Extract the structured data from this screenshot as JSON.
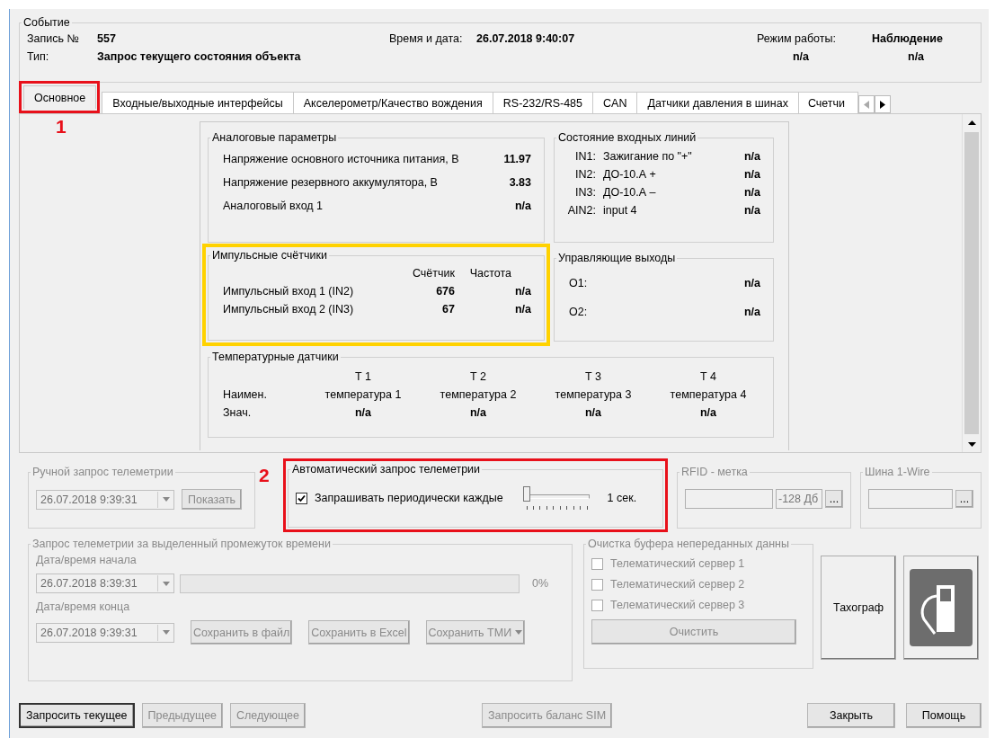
{
  "event": {
    "title": "Событие",
    "record_label": "Запись №",
    "record": "557",
    "datetime_label": "Время и дата:",
    "datetime": "26.07.2018 9:40:07",
    "mode_label": "Режим работы:",
    "mode": "Наблюдение",
    "type_label": "Тип:",
    "type": "Запрос текущего состояния объекта",
    "status_1": "n/a",
    "status_2": "n/a"
  },
  "tabs": [
    {
      "label": "Основное",
      "selected": true,
      "callout": "1"
    },
    {
      "label": "Входные/выходные интерфейсы",
      "selected": false
    },
    {
      "label": "Акселерометр/Качество вождения",
      "selected": false
    },
    {
      "label": "RS-232/RS-485",
      "selected": false
    },
    {
      "label": "CAN",
      "selected": false
    },
    {
      "label": "Датчики давления в шинах",
      "selected": false
    },
    {
      "label": "Счетчи",
      "selected": false
    }
  ],
  "analog": {
    "title": "Аналоговые параметры",
    "rows": [
      {
        "label": "Напряжение основного источника питания, В",
        "value": "11.97"
      },
      {
        "label": "Напряжение резервного аккумулятора, В",
        "value": "3.83"
      },
      {
        "label": "Аналоговый вход 1",
        "value": "n/a"
      }
    ]
  },
  "input_lines": {
    "title": "Состояние входных линий",
    "rows": [
      {
        "pin": "IN1:",
        "label": "Зажигание по \"+\"",
        "value": "n/a"
      },
      {
        "pin": "IN2:",
        "label": "ДО-10.А +",
        "value": "n/a"
      },
      {
        "pin": "IN3:",
        "label": "ДО-10.А –",
        "value": "n/a"
      },
      {
        "pin": "AIN2:",
        "label": "input 4",
        "value": "n/a"
      }
    ]
  },
  "pulse_counters": {
    "title": "Импульсные счётчики",
    "highlighted": true,
    "count_header": "Счётчик",
    "frequency_header": "Частота",
    "rows": [
      {
        "label": "Импульсный вход 1 (IN2)",
        "count": "676",
        "frequency": "n/a"
      },
      {
        "label": "Импульсный вход 2 (IN3)",
        "count": "67",
        "frequency": "n/a"
      }
    ]
  },
  "outputs": {
    "title": "Управляющие выходы",
    "rows": [
      {
        "label": "O1:",
        "value": "n/a"
      },
      {
        "label": "O2:",
        "value": "n/a"
      }
    ]
  },
  "temperature": {
    "title": "Температурные датчики",
    "name_label": "Наимен.",
    "value_label": "Знач.",
    "sensors": [
      {
        "header": "T 1",
        "name": "температура 1",
        "value": "n/a"
      },
      {
        "header": "T 2",
        "name": "температура 2",
        "value": "n/a"
      },
      {
        "header": "T 3",
        "name": "температура 3",
        "value": "n/a"
      },
      {
        "header": "T 4",
        "name": "температура 4",
        "value": "n/a"
      }
    ]
  },
  "manual_request": {
    "title": "Ручной запрос телеметрии",
    "date": "26.07.2018 9:39:31",
    "button": "Показать",
    "disabled": true
  },
  "auto_request": {
    "title": "Автоматический запрос телеметрии",
    "callout": "2",
    "checkbox_label": "Запрашивать периодически каждые",
    "checked": true,
    "slider": {
      "level": 0
    },
    "reading": "1 сек."
  },
  "rfid": {
    "title": "RFID - метка",
    "signal": "-128 Дб",
    "button": "..."
  },
  "one_wire": {
    "title": "Шина 1-Wire",
    "button": "..."
  },
  "period_request": {
    "title": "Запрос телеметрии за выделенный промежуток времени",
    "start_label": "Дата/время начала",
    "start": "26.07.2018 8:39:31",
    "progress": {
      "level": 0
    },
    "percent": "0%",
    "end_label": "Дата/время конца",
    "end": "26.07.2018 9:39:31",
    "buttons": [
      {
        "label": "Сохранить в файл",
        "dropdown": false
      },
      {
        "label": "Сохранить в Excel",
        "dropdown": false
      },
      {
        "label": "Сохранить ТМИ",
        "dropdown": true
      }
    ]
  },
  "clear_buffer": {
    "title": "Очистка буфера непереданных данны",
    "servers": [
      {
        "label": "Телематический сервер 1",
        "checked": false
      },
      {
        "label": "Телематический сервер 2",
        "checked": false
      },
      {
        "label": "Телематический сервер 3",
        "checked": false
      }
    ],
    "button": "Очистить"
  },
  "tachograph_button": "Тахограф",
  "bottom_buttons": [
    {
      "label": "Запросить текущее",
      "disabled": false,
      "focused": true
    },
    {
      "label": "Предыдущее",
      "disabled": true,
      "focused": false
    },
    {
      "label": "Следующее",
      "disabled": true,
      "focused": false
    },
    {
      "label": "Запросить баланс SIM",
      "disabled": true,
      "focused": false
    },
    {
      "label": "Закрыть",
      "disabled": false,
      "focused": false
    },
    {
      "label": "Помощь",
      "disabled": false,
      "focused": false
    }
  ]
}
